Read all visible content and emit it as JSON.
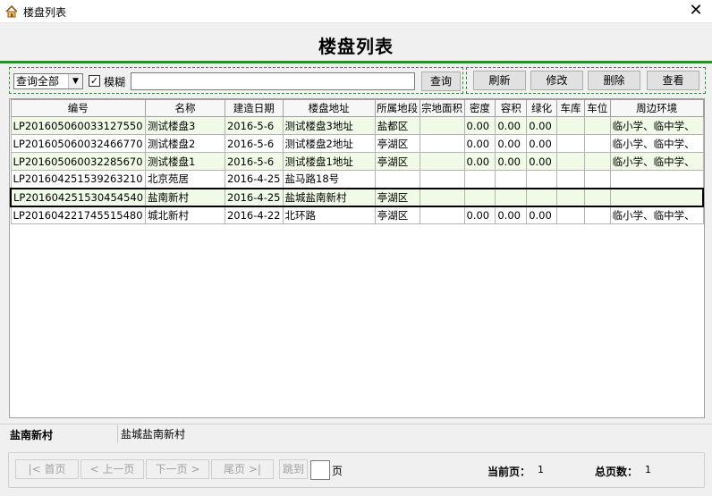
{
  "window": {
    "title": "楼盘列表",
    "close_glyph": "✕",
    "app_icon": "house-icon"
  },
  "header": {
    "title": "楼盘列表"
  },
  "toolbar": {
    "query_mode": "查询全部",
    "fuzzy_checked": true,
    "fuzzy_check_glyph": "✓",
    "fuzzy_label": "模糊",
    "search_value": "",
    "search_label": "查询",
    "refresh_label": "刷新",
    "edit_label": "修改",
    "delete_label": "删除",
    "view_label": "查看"
  },
  "table": {
    "columns": [
      "编号",
      "名称",
      "建造日期",
      "楼盘地址",
      "所属地段",
      "宗地面积",
      "密度",
      "容积",
      "绿化",
      "车库",
      "车位",
      "周边环境"
    ],
    "rows": [
      [
        "LP201605060033127550",
        "测试楼盘3",
        "2016-5-6",
        "测试楼盘3地址",
        "盐都区",
        "",
        "0.00",
        "0.00",
        "0.00",
        "",
        "",
        "临小学、临中学、"
      ],
      [
        "LP201605060032466770",
        "测试楼盘2",
        "2016-5-6",
        "测试楼盘2地址",
        "亭湖区",
        "",
        "0.00",
        "0.00",
        "0.00",
        "",
        "",
        "临小学、临中学、"
      ],
      [
        "LP201605060032285670",
        "测试楼盘1",
        "2016-5-6",
        "测试楼盘1地址",
        "亭湖区",
        "",
        "0.00",
        "0.00",
        "0.00",
        "",
        "",
        "临小学、临中学、"
      ],
      [
        "LP201604251539263210",
        "北京苑居",
        "2016-4-25",
        "盐马路18号",
        "",
        "",
        "",
        "",
        "",
        "",
        "",
        ""
      ],
      [
        "LP201604251530454540",
        "盐南新村",
        "2016-4-25",
        "盐城盐南新村",
        "亭湖区",
        "",
        "",
        "",
        "",
        "",
        "",
        ""
      ],
      [
        "LP201604221745515480",
        "城北新村",
        "2016-4-22",
        "北环路",
        "亭湖区",
        "",
        "0.00",
        "0.00",
        "0.00",
        "",
        "",
        "临小学、临中学、"
      ]
    ],
    "selected_row": 4
  },
  "detail": {
    "name": "盐南新村",
    "address": "盐城盐南新村"
  },
  "pager": {
    "first_label": "|< 首页",
    "prev_label": "< 上一页",
    "next_label": "下一页 >",
    "last_label": "尾页 >|",
    "jump_label": "跳到",
    "jump_value": "",
    "page_unit": "页",
    "current_label": "当前页：",
    "current_value": "1",
    "total_label": "总页数：",
    "total_value": "1"
  },
  "colors": {
    "accent_green": "#2e8b2e",
    "row_alt": "#f0fae6"
  }
}
